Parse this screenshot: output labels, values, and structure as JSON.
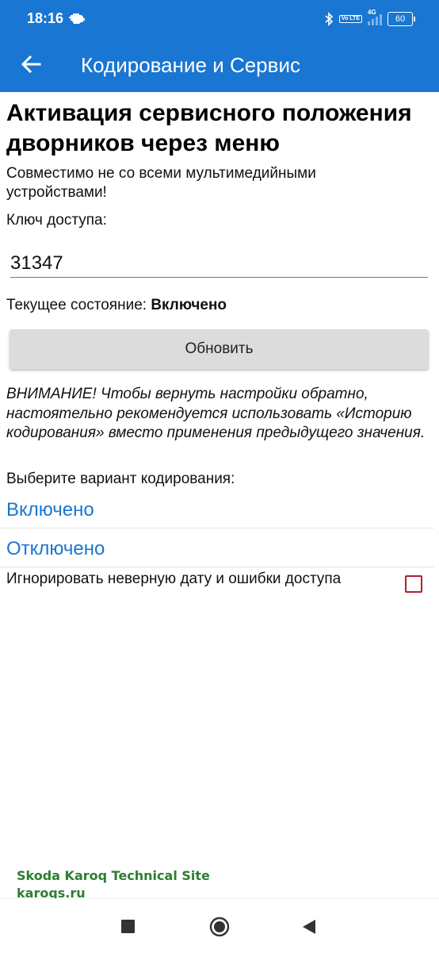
{
  "status": {
    "time": "18:16",
    "volte_label": "Vo LTE",
    "network": "4G",
    "battery": "60"
  },
  "appbar": {
    "title": "Кодирование и Сервис"
  },
  "page": {
    "title": "Активация сервисного положения дворников через меню",
    "compat_note": "Совместимо не со всеми мультимедийными устройствами!",
    "key_label": "Ключ доступа:",
    "key_value": "31347",
    "state_label": "Текущее состояние: ",
    "state_value": "Включено",
    "refresh_button": "Обновить",
    "warning": "ВНИМАНИЕ! Чтобы вернуть настройки обратно, настоятельно рекомендуется использовать «Историю кодирования» вместо применения предыдущего значения.",
    "choose_label": "Выберите вариант кодирования:",
    "options": [
      {
        "label": "Включено"
      },
      {
        "label": "Отключено"
      }
    ],
    "ignore_label": "Игнорировать неверную дату и ошибки доступа",
    "ignore_checked": false
  },
  "watermark": {
    "line1": "Skoda Karoq Technical Site",
    "line2": "karoqs.ru"
  },
  "colors": {
    "primary": "#1976D2",
    "option_text": "#1976D2",
    "checkbox": "#b02030",
    "watermark": "#2e7d32"
  },
  "icons": {
    "back": "arrow-left-icon",
    "engine": "check-engine-icon",
    "bluetooth": "bluetooth-icon",
    "nav_recent": "square-icon",
    "nav_home": "circle-icon",
    "nav_back": "triangle-back-icon"
  }
}
